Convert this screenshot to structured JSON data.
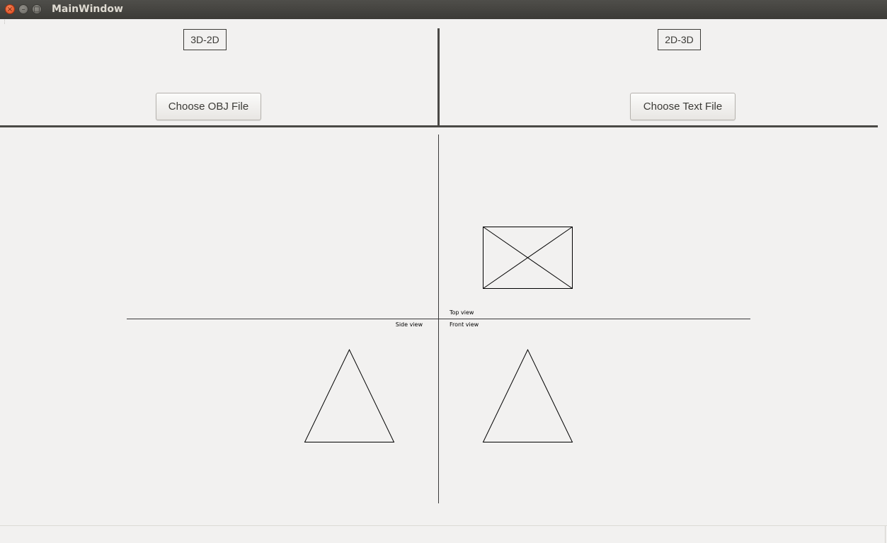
{
  "window": {
    "title": "MainWindow",
    "close_glyph": "×",
    "minimize_glyph": "–",
    "maximize_glyph": "□"
  },
  "left_panel": {
    "mode_label": "3D-2D",
    "choose_button": "Choose OBJ File"
  },
  "right_panel": {
    "mode_label": "2D-3D",
    "choose_button": "Choose Text File"
  },
  "drawing": {
    "top_view_label": "Top view",
    "side_view_label": "Side view",
    "front_view_label": "Front view"
  }
}
